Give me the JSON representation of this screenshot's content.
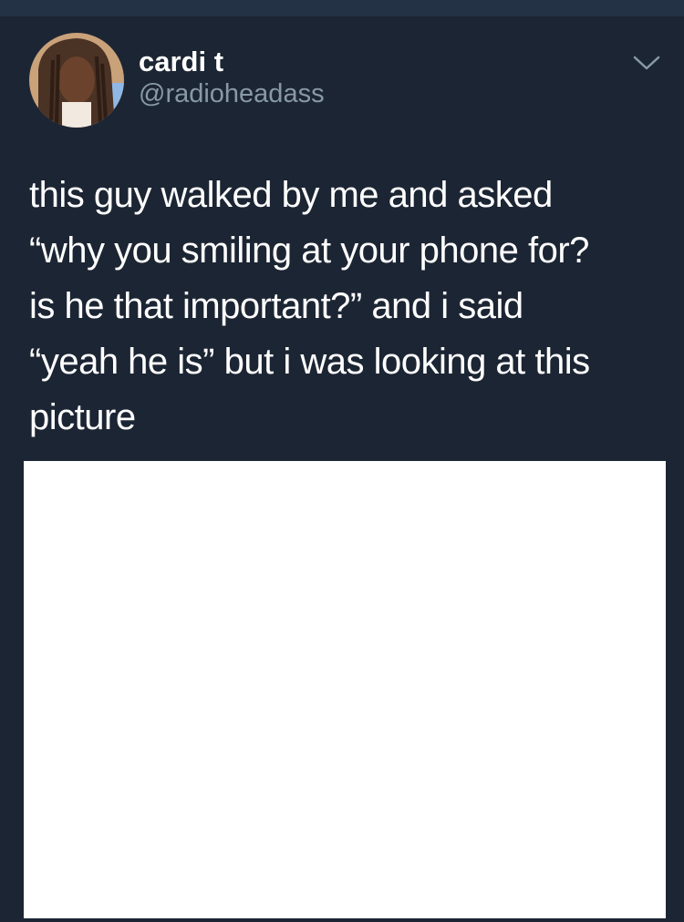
{
  "tweet": {
    "author": {
      "display_name": "cardi t",
      "handle": "@radioheadass",
      "avatar_icon": "profile-photo"
    },
    "text": "this guy walked by me and asked\n“why you smiling at your phone for?\nis he that important?” and i said\n“yeah he is” but i was looking at this\npicture",
    "menu_icon": "chevron-down-icon",
    "media": {
      "type": "image",
      "background": "#ffffff"
    }
  },
  "colors": {
    "background": "#1c2533",
    "top_strip": "#243246",
    "text": "#ffffff",
    "secondary_text": "#8899a6",
    "chevron": "#8899a6"
  }
}
